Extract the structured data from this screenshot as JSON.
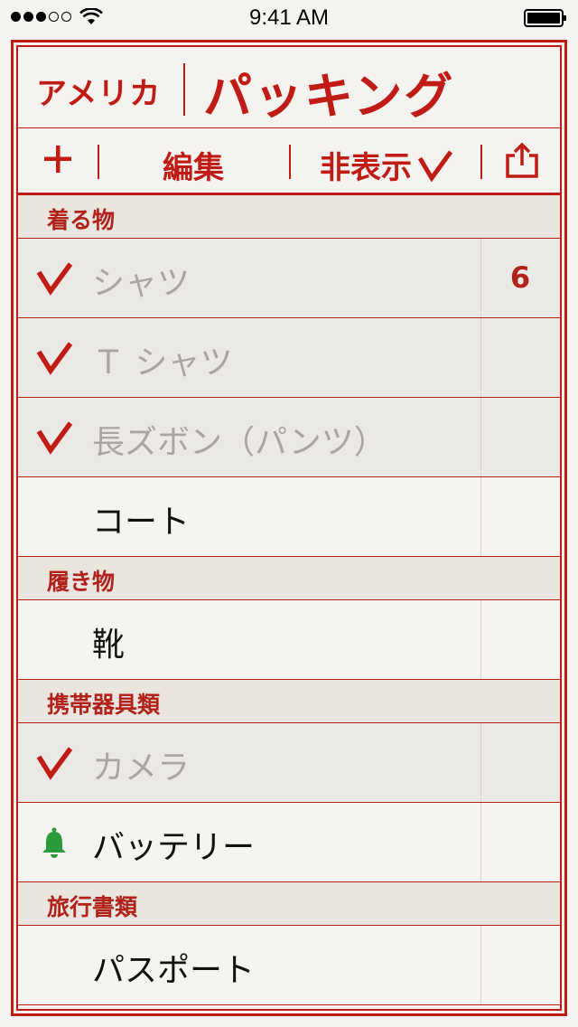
{
  "status_bar": {
    "time": "9:41 AM"
  },
  "header": {
    "small_title": "アメリカ",
    "large_title": "パッキング"
  },
  "toolbar": {
    "edit_label": "編集",
    "hide_label": "非表示"
  },
  "sections": [
    {
      "title": "着る物",
      "items": [
        {
          "label": "シャツ",
          "checked": true,
          "count": "6"
        },
        {
          "label": "Ｔ シャツ",
          "checked": true
        },
        {
          "label": "長ズボン（パンツ）",
          "checked": true
        },
        {
          "label": "コート",
          "checked": false
        }
      ]
    },
    {
      "title": "履き物",
      "items": [
        {
          "label": "靴",
          "checked": false
        }
      ]
    },
    {
      "title": "携帯器具類",
      "items": [
        {
          "label": "カメラ",
          "checked": true
        },
        {
          "label": "バッテリー",
          "checked": false,
          "icon": "bell-icon"
        }
      ]
    },
    {
      "title": "旅行書類",
      "items": [
        {
          "label": "パスポート",
          "checked": false
        }
      ]
    }
  ],
  "colors": {
    "accent": "#c01c15",
    "bell": "#2a9a3a",
    "background": "#f4f3ef"
  }
}
